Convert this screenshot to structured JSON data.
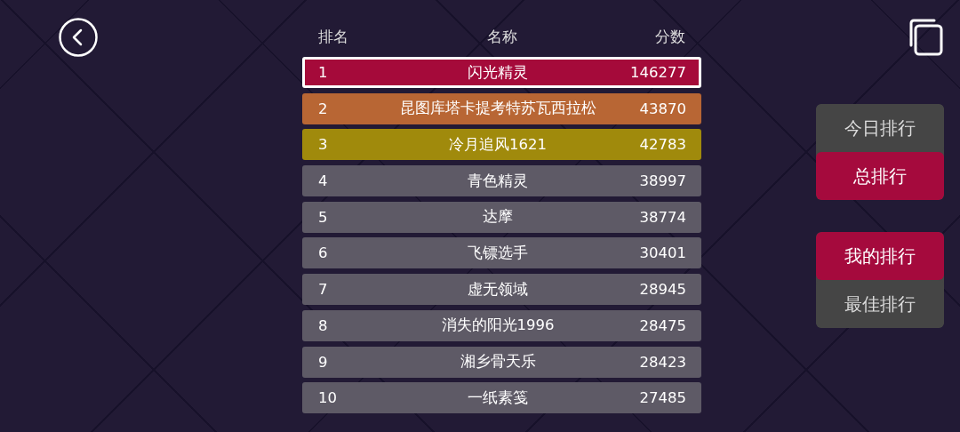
{
  "table": {
    "columns": [
      "排名",
      "名称",
      "分数"
    ],
    "rows": [
      {
        "rank": "1",
        "name": "闪光精灵",
        "score": "146277",
        "color": "#a50a3a",
        "selected": true
      },
      {
        "rank": "2",
        "name": "昆图库塔卡提考特苏瓦西拉松",
        "score": "43870",
        "color": "#b86634",
        "selected": false
      },
      {
        "rank": "3",
        "name": "冷月追风1621",
        "score": "42783",
        "color": "#a08a0c",
        "selected": false
      },
      {
        "rank": "4",
        "name": "青色精灵",
        "score": "38997",
        "color": "#5e5a66",
        "selected": false
      },
      {
        "rank": "5",
        "name": "达摩",
        "score": "38774",
        "color": "#5e5a66",
        "selected": false
      },
      {
        "rank": "6",
        "name": "飞镖选手",
        "score": "30401",
        "color": "#5e5a66",
        "selected": false
      },
      {
        "rank": "7",
        "name": "虚无领域",
        "score": "28945",
        "color": "#5e5a66",
        "selected": false
      },
      {
        "rank": "8",
        "name": "消失的阳光1996",
        "score": "28475",
        "color": "#5e5a66",
        "selected": false
      },
      {
        "rank": "9",
        "name": "湘乡骨天乐",
        "score": "28423",
        "color": "#5e5a66",
        "selected": false
      },
      {
        "rank": "10",
        "name": "一纸素笺",
        "score": "27485",
        "color": "#5e5a66",
        "selected": false
      }
    ]
  },
  "period_tabs": [
    {
      "label": "今日排行",
      "selected": false
    },
    {
      "label": "总排行",
      "selected": true
    }
  ],
  "scope_tabs": [
    {
      "label": "我的排行",
      "selected": true
    },
    {
      "label": "最佳排行",
      "selected": false
    }
  ]
}
